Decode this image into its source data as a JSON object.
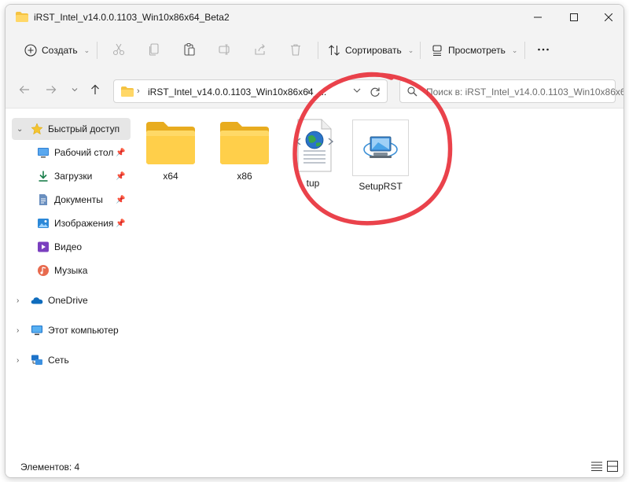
{
  "window": {
    "title": "iRST_Intel_v14.0.0.1103_Win10x86x64_Beta2",
    "controls": [
      "minimize-icon",
      "maximize-icon",
      "close-icon"
    ]
  },
  "toolbar": {
    "create_label": "Создать",
    "sort_label": "Сортировать",
    "view_label": "Просмотреть",
    "icons": [
      "cut-icon",
      "copy-icon",
      "paste-icon",
      "rename-icon",
      "share-icon",
      "delete-icon",
      "more-icon"
    ]
  },
  "address": {
    "path": "iRST_Intel_v14.0.0.1103_Win10x86x64_...",
    "search_placeholder": "Поиск в: iRST_Intel_v14.0.0.1103_Win10x86x6..."
  },
  "sidebar": {
    "items": [
      {
        "label": "Быстрый доступ",
        "icon": "star-icon",
        "pinned": false
      },
      {
        "label": "Рабочий стол",
        "icon": "desktop-icon",
        "pinned": true
      },
      {
        "label": "Загрузки",
        "icon": "download-icon",
        "pinned": true
      },
      {
        "label": "Документы",
        "icon": "documents-icon",
        "pinned": true
      },
      {
        "label": "Изображения",
        "icon": "pictures-icon",
        "pinned": true
      },
      {
        "label": "Видео",
        "icon": "video-icon",
        "pinned": false
      },
      {
        "label": "Музыка",
        "icon": "music-icon",
        "pinned": false
      },
      {
        "label": "OneDrive",
        "icon": "cloud-icon",
        "pinned": false
      },
      {
        "label": "Этот компьютер",
        "icon": "computer-icon",
        "pinned": false
      },
      {
        "label": "Сеть",
        "icon": "network-icon",
        "pinned": false
      }
    ]
  },
  "files": [
    {
      "name": "x64",
      "type": "folder"
    },
    {
      "name": "x86",
      "type": "folder"
    },
    {
      "name": "tup",
      "type": "xml-file"
    },
    {
      "name": "SetupRST",
      "type": "application"
    }
  ],
  "status": {
    "items_count": "Элементов: 4"
  },
  "colors": {
    "accent": "#0067c0",
    "folder_yellow": "#f7c948",
    "annotation_red": "#e8323c"
  }
}
